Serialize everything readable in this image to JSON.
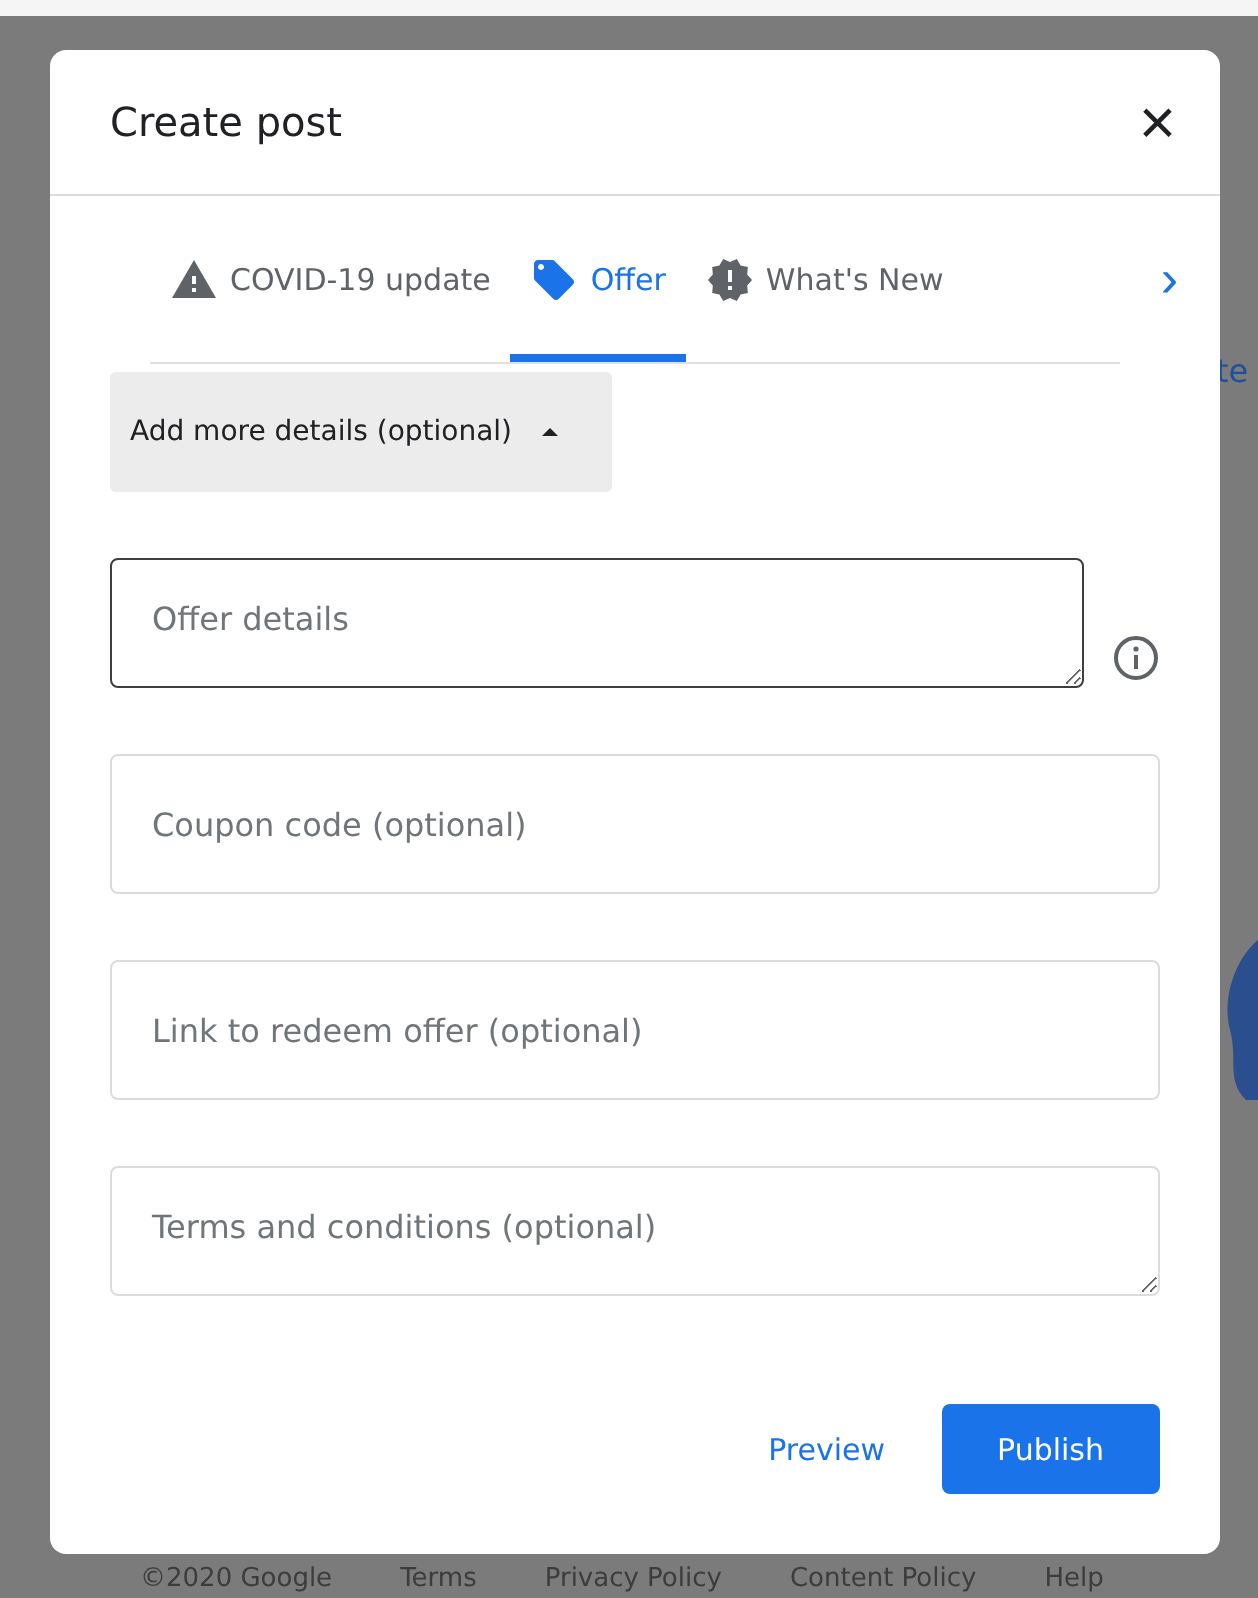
{
  "background": {
    "link_fragment": "te",
    "footer_links": [
      "©2020 Google",
      "Terms",
      "Privacy Policy",
      "Content Policy",
      "Help"
    ]
  },
  "dialog": {
    "title": "Create post",
    "close": "×"
  },
  "tabs": [
    {
      "label": "COVID-19 update",
      "kind": "warning",
      "selected": false
    },
    {
      "label": "Offer",
      "kind": "tag",
      "selected": true
    },
    {
      "label": "What's New",
      "kind": "alert",
      "selected": false
    }
  ],
  "tabs_next": "›",
  "details_toggle": {
    "label": "Add more details (optional)",
    "expanded": true
  },
  "fields": [
    {
      "placeholder": "Offer details",
      "kind": "textarea",
      "focused": true,
      "info": true
    },
    {
      "placeholder": "Coupon code (optional)",
      "kind": "input",
      "focused": false,
      "info": false
    },
    {
      "placeholder": "Link to redeem offer (optional)",
      "kind": "input",
      "focused": false,
      "info": false
    },
    {
      "placeholder": "Terms and conditions (optional)",
      "kind": "textarea",
      "focused": false,
      "info": false
    }
  ],
  "actions": {
    "preview": "Preview",
    "publish": "Publish"
  }
}
